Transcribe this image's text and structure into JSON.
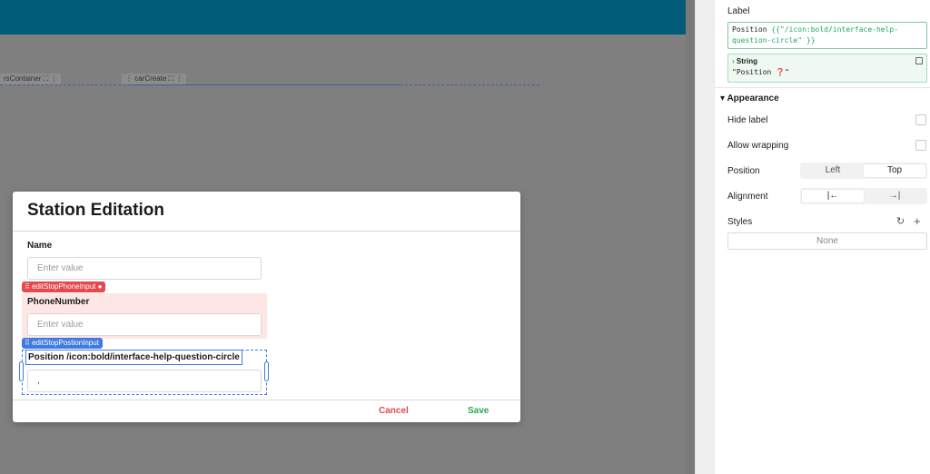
{
  "canvas": {
    "chips": [
      "rsContainer",
      "carCreate"
    ]
  },
  "dialog": {
    "title": "Station Editation",
    "name_label": "Name",
    "name_placeholder": "Enter value",
    "phone_badge": "editStopPhoneInput",
    "phone_label": "PhoneNumber",
    "phone_placeholder": "Enter value",
    "position_badge": "editStopPostionInput",
    "position_label": "Position /icon:bold/interface-help-question-circle",
    "position_value": ",",
    "cancel_label": "Cancel",
    "save_label": "Save"
  },
  "panel": {
    "label_title": "Label",
    "code_prefix": "Position ",
    "code_expr": "{{\"/icon:bold/interface-help-question-circle\" }}",
    "result_type": "String",
    "result_value": "\"Position ❓\"",
    "appearance": "Appearance",
    "hide_label": "Hide label",
    "allow_wrapping": "Allow wrapping",
    "position_label": "Position",
    "position_options": [
      "Left",
      "Top"
    ],
    "position_selected": "Top",
    "alignment_label": "Alignment",
    "alignment_options": [
      "|←",
      "→|"
    ],
    "styles_label": "Styles",
    "styles_value": "None"
  },
  "colors": {
    "topbar": "#005b78",
    "danger": "#e5484d",
    "success": "#2fa84f",
    "selection": "#3f7be0"
  }
}
